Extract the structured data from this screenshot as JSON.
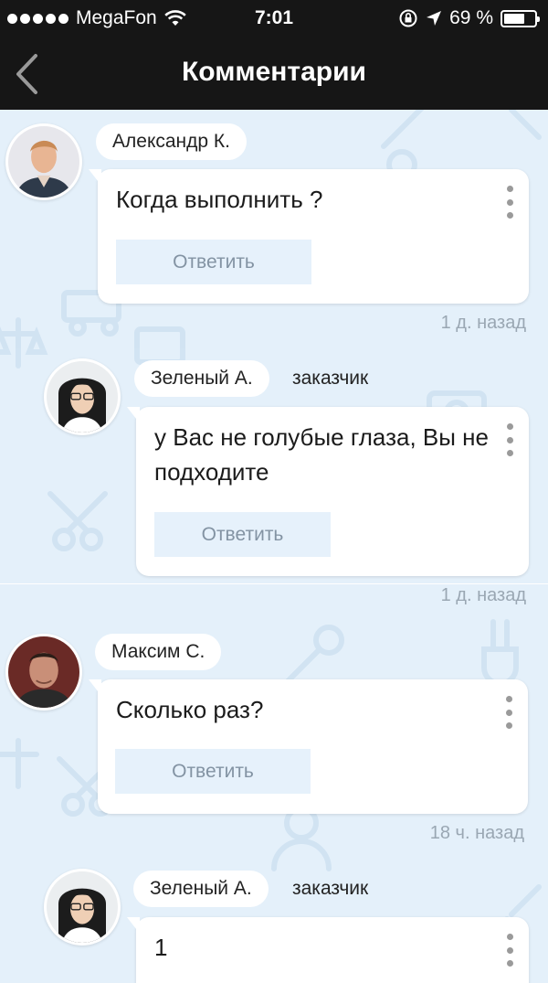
{
  "status_bar": {
    "carrier": "MegaFon",
    "time": "7:01",
    "battery": "69 %",
    "battery_level": 0.69
  },
  "nav": {
    "title": "Комментарии",
    "back_icon": "chevron-left-icon"
  },
  "comments": [
    {
      "author": "Александр К.",
      "role": "",
      "text": "Когда выполнить ?",
      "reply_label": "Ответить",
      "time_ago": "1 д. назад"
    },
    {
      "author": "Зеленый А.",
      "role": "заказчик",
      "text": "у Вас не голубые глаза, Вы не подходите",
      "reply_label": "Ответить",
      "time_ago": "1 д. назад"
    },
    {
      "author": "Максим С.",
      "role": "",
      "text": "Сколько раз?",
      "reply_label": "Ответить",
      "time_ago": "18 ч. назад"
    },
    {
      "author": "Зеленый А.",
      "role": "заказчик",
      "text": "1",
      "reply_label": "",
      "time_ago": ""
    }
  ],
  "colors": {
    "bar_bg": "#161616",
    "feed_bg": "#e4f0fa",
    "reply_bg": "#e6f1fb",
    "reply_text": "#8393a3",
    "muted": "#9aa7b3"
  }
}
